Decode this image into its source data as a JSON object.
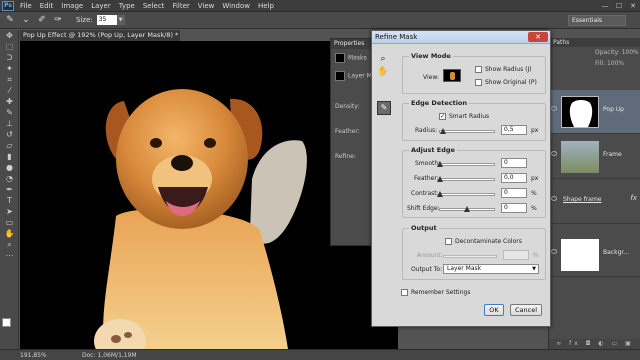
{
  "menubar": {
    "logo": "Ps",
    "items": [
      "File",
      "Edit",
      "Image",
      "Layer",
      "Type",
      "Select",
      "Filter",
      "View",
      "Window",
      "Help"
    ],
    "win_min": "—",
    "win_max": "☐",
    "win_close": "✕"
  },
  "options": {
    "size_label": "Size:",
    "size_value": "35",
    "workspace": "Essentials"
  },
  "document": {
    "tab_title": "Pop Up Effect @ 192% (Pop Up, Layer Mask/8) *",
    "tab_close": "×",
    "zoom": "191,85%",
    "doc_info": "Doc: 1,06M/1,19M"
  },
  "properties": {
    "tab": "Properties",
    "masks_label": "Masks",
    "layer_label": "Layer M",
    "density": "Density:",
    "feather": "Feather:",
    "refine": "Refine:"
  },
  "right_panel": {
    "header": "Paths",
    "opacity": "Opacity:",
    "opacity_value": "100%",
    "fill": "Fill:",
    "fill_value": "100%",
    "layers": [
      {
        "name": "Pop Up",
        "fx": ""
      },
      {
        "name": "Frame",
        "fx": ""
      },
      {
        "name": "Shape frame",
        "fx": "fx"
      },
      {
        "name": "Backgr...",
        "fx": ""
      }
    ],
    "footer": "∞ fx ◘ ◐ ▭ ▣ 🗑"
  },
  "dialog": {
    "title": "Refine Mask",
    "close": "✕",
    "view_mode": {
      "title": "View Mode",
      "view_label": "View:",
      "show_radius": "Show Radius (J)",
      "show_original": "Show Original (P)"
    },
    "edge_detection": {
      "title": "Edge Detection",
      "smart_radius": "Smart Radius",
      "smart_radius_checked": "✓",
      "radius_label": "Radius:",
      "radius_value": "0,5",
      "radius_unit": "px",
      "radius_level": 0.05
    },
    "adjust_edge": {
      "title": "Adjust Edge",
      "smooth_label": "Smooth:",
      "smooth_value": "0",
      "smooth_level": 0,
      "feather_label": "Feather:",
      "feather_value": "0,0",
      "feather_unit": "px",
      "feather_level": 0,
      "contrast_label": "Contrast:",
      "contrast_value": "0",
      "contrast_unit": "%",
      "contrast_level": 0,
      "shift_label": "Shift Edge:",
      "shift_value": "0",
      "shift_unit": "%",
      "shift_level": 0.5
    },
    "output": {
      "title": "Output",
      "decontaminate": "Decontaminate Colors",
      "amount_label": "Amount:",
      "amount_unit": "%",
      "output_to_label": "Output To:",
      "output_to_value": "Layer Mask"
    },
    "remember": "Remember Settings",
    "ok": "OK",
    "cancel": "Cancel"
  }
}
